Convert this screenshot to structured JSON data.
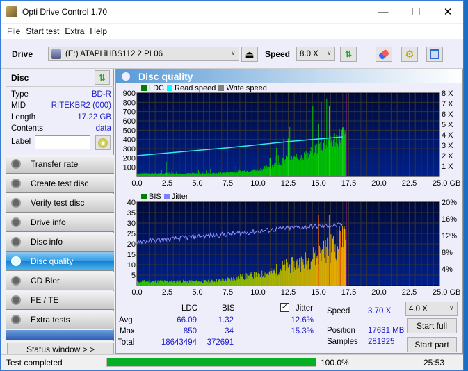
{
  "window": {
    "title": "Opti Drive Control 1.70",
    "controls": {
      "minimize": "—",
      "maximize": "☐",
      "close": "✕"
    }
  },
  "menu": [
    "File",
    "Start test",
    "Extra",
    "Help"
  ],
  "toolbar": {
    "drive_label": "Drive",
    "drive_value": "(E:)  ATAPI iHBS112   2 PL06",
    "speed_label": "Speed",
    "speed_value": "8.0 X",
    "eject": "⏏"
  },
  "disc": {
    "header": "Disc",
    "rows": [
      {
        "label": "Type",
        "value": "BD-R"
      },
      {
        "label": "MID",
        "value": "RITEKBR2 (000)"
      },
      {
        "label": "Length",
        "value": "17.22 GB"
      },
      {
        "label": "Contents",
        "value": "data"
      }
    ],
    "label_field": "Label",
    "label_value": ""
  },
  "nav": [
    {
      "label": "Transfer rate",
      "active": false
    },
    {
      "label": "Create test disc",
      "active": false
    },
    {
      "label": "Verify test disc",
      "active": false
    },
    {
      "label": "Drive info",
      "active": false
    },
    {
      "label": "Disc info",
      "active": false
    },
    {
      "label": "Disc quality",
      "active": true
    },
    {
      "label": "CD Bler",
      "active": false
    },
    {
      "label": "FE / TE",
      "active": false
    },
    {
      "label": "Extra tests",
      "active": false
    }
  ],
  "status_window": "Status window > >",
  "panel": {
    "title": "Disc quality"
  },
  "stats": {
    "col_ldc": "LDC",
    "col_bis": "BIS",
    "jitter_label": "Jitter",
    "jitter_checked": true,
    "rows": [
      {
        "label": "Avg",
        "ldc": "66.09",
        "bis": "1.32",
        "jitter": "12.6%"
      },
      {
        "label": "Max",
        "ldc": "850",
        "bis": "34",
        "jitter": "15.3%"
      },
      {
        "label": "Total",
        "ldc": "18643494",
        "bis": "372691",
        "jitter": ""
      }
    ],
    "speed_label": "Speed",
    "speed_value": "3.70 X",
    "position_label": "Position",
    "position_value": "17631 MB",
    "samples_label": "Samples",
    "samples_value": "281925",
    "test_speed": "4.0 X",
    "start_full": "Start full",
    "start_part": "Start part"
  },
  "statusbar": {
    "text": "Test completed",
    "progress": 1.0,
    "progress_text": "100.0%",
    "time": "25:53"
  },
  "chart_data": [
    {
      "type": "bar",
      "title": "LDC",
      "legend": [
        "LDC",
        "Read speed",
        "Write speed"
      ],
      "legend_colors": [
        "#008000",
        "#00ffff",
        "#808080"
      ],
      "x_ticks": [
        "0.0",
        "2.5",
        "5.0",
        "7.5",
        "10.0",
        "12.5",
        "15.0",
        "17.5",
        "20.0",
        "22.5",
        "25.0 GB"
      ],
      "xlim": [
        0,
        25
      ],
      "ylim": [
        0,
        900
      ],
      "y_ticks": [
        "100",
        "200",
        "300",
        "400",
        "500",
        "600",
        "700",
        "800",
        "900"
      ],
      "y2_ticks": [
        "1 X",
        "2 X",
        "3 X",
        "4 X",
        "5 X",
        "6 X",
        "7 X",
        "8 X"
      ],
      "y2lim": [
        0,
        8
      ],
      "ldc_x": [
        0,
        1,
        2,
        2.5,
        3,
        4,
        5,
        6,
        7,
        8,
        9,
        10,
        10.5,
        11,
        11.5,
        12,
        12.5,
        13,
        13.5,
        14,
        14.5,
        15,
        15.5,
        16,
        16.5,
        17,
        17.2
      ],
      "ldc_y": [
        30,
        35,
        30,
        40,
        32,
        30,
        35,
        32,
        38,
        50,
        60,
        75,
        90,
        110,
        130,
        160,
        200,
        190,
        210,
        230,
        280,
        320,
        360,
        380,
        420,
        450,
        420
      ],
      "read_speed_x": [
        0,
        2.5,
        5,
        7.5,
        10,
        12.5,
        15,
        17.2
      ],
      "read_speed_y": [
        2.0,
        2.25,
        2.5,
        2.75,
        3.05,
        3.35,
        3.6,
        3.82
      ],
      "spikes": [
        {
          "x": 2.4,
          "y": 160
        },
        {
          "x": 11.0,
          "y": 200
        },
        {
          "x": 12.5,
          "y": 410
        },
        {
          "x": 15.0,
          "y": 570
        },
        {
          "x": 15.9,
          "y": 760
        },
        {
          "x": 17.0,
          "y": 530
        }
      ],
      "end_marker_x": 17.3
    },
    {
      "type": "bar",
      "title": "BIS",
      "legend": [
        "BIS",
        "Jitter"
      ],
      "legend_colors": [
        "#008000",
        "#8080ff"
      ],
      "x_ticks": [
        "0.0",
        "2.5",
        "5.0",
        "7.5",
        "10.0",
        "12.5",
        "15.0",
        "17.5",
        "20.0",
        "22.5",
        "25.0 GB"
      ],
      "xlim": [
        0,
        25
      ],
      "ylim": [
        0,
        40
      ],
      "y_ticks": [
        "5",
        "10",
        "15",
        "20",
        "25",
        "30",
        "35",
        "40"
      ],
      "y2_ticks": [
        "4%",
        "8%",
        "12%",
        "16%",
        "20%"
      ],
      "y2lim": [
        0,
        20
      ],
      "bis_x": [
        0,
        2,
        4,
        6,
        7.5,
        8.5,
        10,
        11,
        12,
        13,
        14,
        15,
        16,
        17,
        17.2
      ],
      "bis_y": [
        2,
        2,
        2,
        2,
        3,
        4,
        5,
        6,
        9,
        10,
        12,
        15,
        18,
        22,
        20
      ],
      "jitter_x": [
        0,
        2.5,
        5,
        7.5,
        10,
        12.5,
        15,
        17
      ],
      "jitter_y": [
        10.5,
        11.0,
        11.8,
        12.3,
        13.0,
        13.8,
        14.2,
        14.5
      ],
      "spikes": [
        {
          "x": 15.0,
          "y": 34
        },
        {
          "x": 15.9,
          "y": 34
        },
        {
          "x": 16.8,
          "y": 26
        }
      ],
      "end_marker_x": 17.3
    }
  ]
}
